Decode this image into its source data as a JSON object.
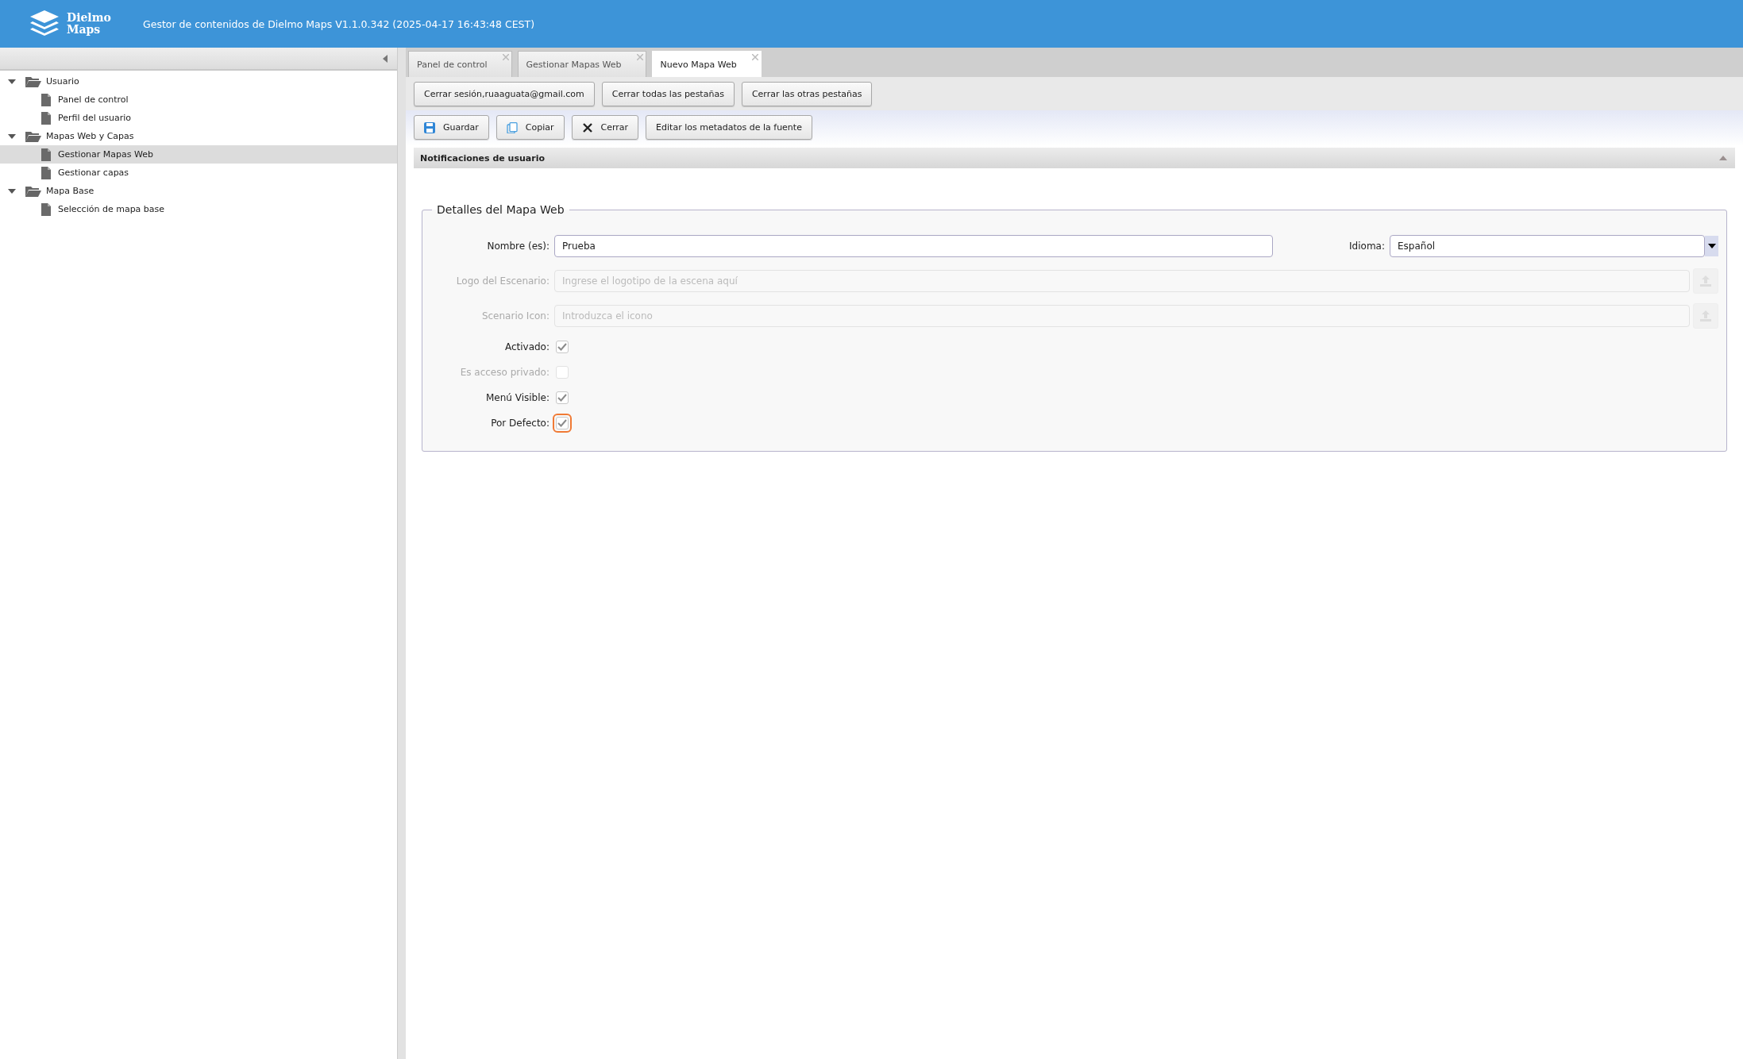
{
  "header": {
    "logo_lines": [
      "Dielmo",
      "Maps"
    ],
    "title": "Gestor de contenidos de Dielmo Maps V1.1.0.342 (2025-04-17 16:43:48 CEST)"
  },
  "sidebar": {
    "items": [
      {
        "label": "Usuario",
        "expanded": true,
        "selected": false,
        "children": [
          {
            "label": "Panel de control",
            "selected": false
          },
          {
            "label": "Perfil del usuario",
            "selected": false
          }
        ]
      },
      {
        "label": "Mapas Web y Capas",
        "expanded": true,
        "selected": false,
        "children": [
          {
            "label": "Gestionar Mapas Web",
            "selected": true
          },
          {
            "label": "Gestionar capas",
            "selected": false
          }
        ]
      },
      {
        "label": "Mapa Base",
        "expanded": true,
        "selected": false,
        "children": [
          {
            "label": "Selección de mapa base",
            "selected": false
          }
        ]
      }
    ]
  },
  "tabs": [
    {
      "label": "Panel de control",
      "selected": false
    },
    {
      "label": "Gestionar Mapas Web",
      "selected": false
    },
    {
      "label": "Nuevo Mapa Web",
      "selected": true
    }
  ],
  "session_buttons": [
    "Cerrar sesión,ruaaguata@gmail.com",
    "Cerrar todas las pestañas",
    "Cerrar las otras pestañas"
  ],
  "toolbar": [
    {
      "label": "Guardar",
      "kind": "save"
    },
    {
      "label": "Copiar",
      "kind": "copy"
    },
    {
      "label": "Cerrar",
      "kind": "close"
    },
    {
      "label": "Editar los metadatos de la fuente",
      "kind": "plain"
    }
  ],
  "notifications": {
    "title": "Notificaciones de usuario",
    "expanded": true
  },
  "details": {
    "legend": "Detalles del Mapa Web",
    "rows": [
      {
        "kind": "pair",
        "fields": [
          {
            "kind": "text",
            "label": "Nombre (es):",
            "value": "Prueba",
            "disabled": false
          },
          {
            "kind": "select",
            "label": "Idioma:",
            "value": "Español",
            "disabled": false
          }
        ]
      },
      {
        "kind": "upload",
        "label": "Logo del Escenario:",
        "placeholder": "Ingrese el logotipo de la escena aquí",
        "disabled": true
      },
      {
        "kind": "upload",
        "label": "Scenario Icon:",
        "placeholder": "Introduzca el icono",
        "disabled": true
      },
      {
        "kind": "checkbox",
        "label": "Activado:",
        "checked": true,
        "disabled": false,
        "focused": false
      },
      {
        "kind": "checkbox",
        "label": "Es acceso privado:",
        "checked": false,
        "disabled": true,
        "focused": false
      },
      {
        "kind": "checkbox",
        "label": "Menú Visible:",
        "checked": true,
        "disabled": false,
        "focused": false
      },
      {
        "kind": "checkbox",
        "label": "Por Defecto:",
        "checked": true,
        "disabled": false,
        "focused": true
      }
    ]
  }
}
